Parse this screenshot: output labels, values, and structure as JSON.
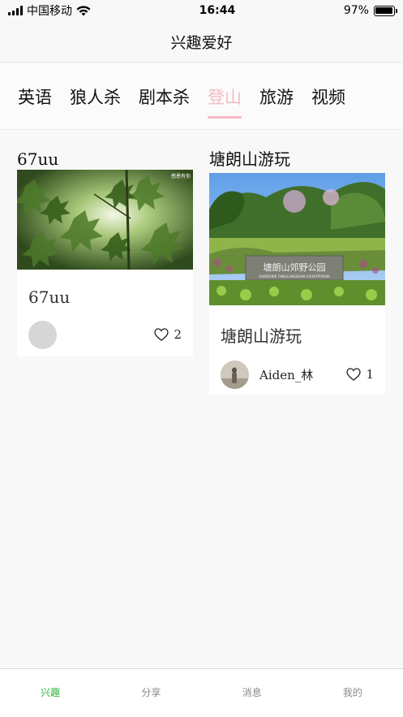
{
  "status": {
    "carrier": "中国移动",
    "time": "16:44",
    "battery": "97%",
    "battery_level": 0.97
  },
  "nav": {
    "title": "兴趣爱好"
  },
  "tabs": [
    {
      "label": "英语",
      "active": false
    },
    {
      "label": "狼人杀",
      "active": false
    },
    {
      "label": "剧本杀",
      "active": false
    },
    {
      "label": "登山",
      "active": true
    },
    {
      "label": "旅游",
      "active": false
    },
    {
      "label": "视频",
      "active": false
    }
  ],
  "posts": [
    {
      "header": "67uu",
      "title": "67uu",
      "author": "",
      "likes": "2",
      "image": "maple-leaves-photo",
      "image_caption": "感恩有你"
    },
    {
      "header": "塘朗山游玩",
      "title": "塘朗山游玩",
      "author": "Aiden_林",
      "likes": "1",
      "image": "park-sign-photo",
      "sign_text": "塘朗山郊野公园",
      "sign_text_en": "SHENZHEN TANGLANGSHAN COUNTRYPARK"
    }
  ],
  "tabbar": [
    {
      "label": "兴趣",
      "active": true
    },
    {
      "label": "分享",
      "active": false
    },
    {
      "label": "消息",
      "active": false
    },
    {
      "label": "我的",
      "active": false
    }
  ],
  "colors": {
    "accent_tab": "#f6b9c6",
    "tabbar_active": "#2fb53a",
    "tabbar_inactive": "#888888"
  }
}
